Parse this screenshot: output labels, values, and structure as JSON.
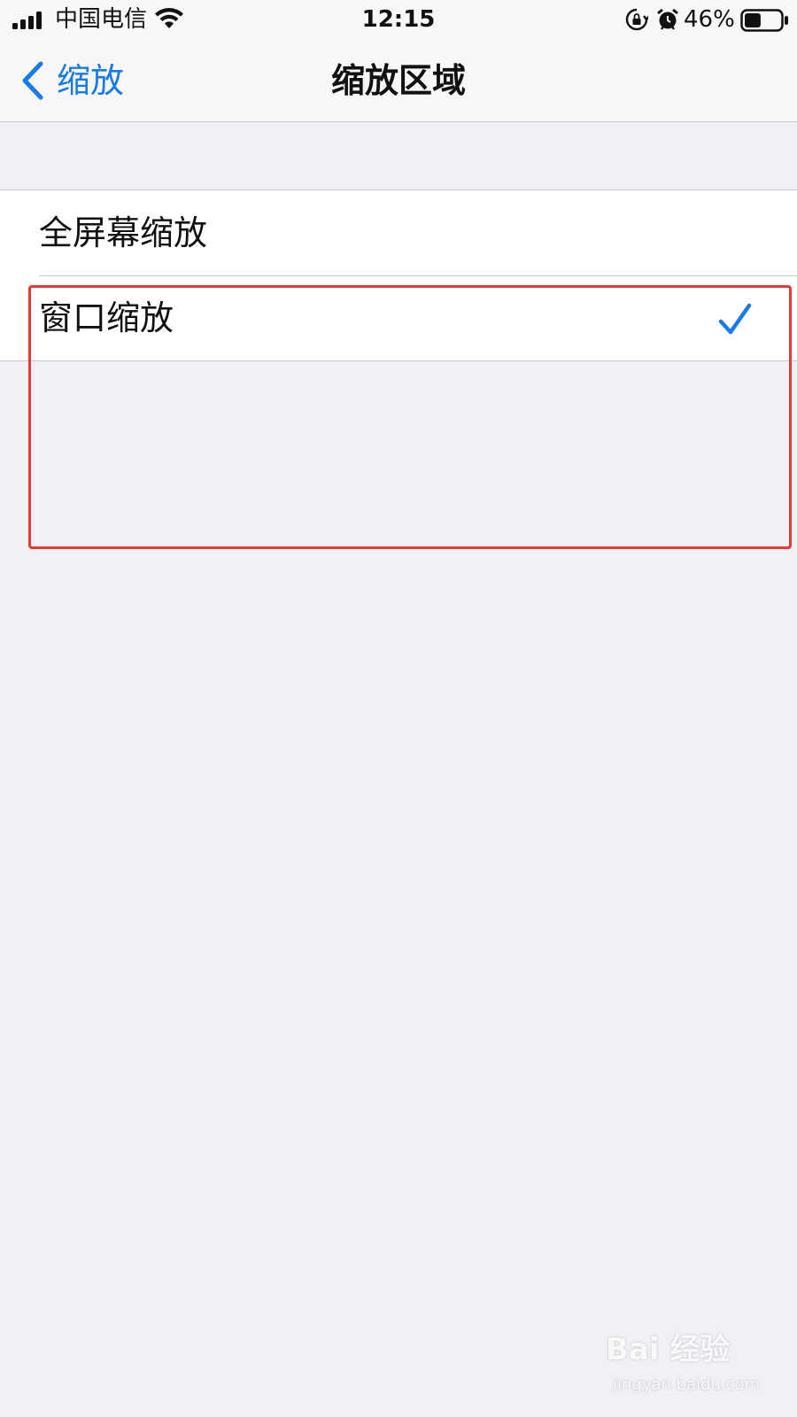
{
  "status_bar": {
    "carrier": "中国电信",
    "time": "12:15",
    "battery_percent": "46%",
    "battery_level": 0.46,
    "icons": [
      "signal-icon",
      "wifi-icon",
      "orientation-lock-icon",
      "alarm-icon",
      "battery-icon"
    ]
  },
  "nav": {
    "back_label": "缩放",
    "title": "缩放区域"
  },
  "options": [
    {
      "label": "全屏幕缩放",
      "selected": false
    },
    {
      "label": "窗口缩放",
      "selected": true
    }
  ],
  "colors": {
    "accent": "#1a7ae6",
    "background": "#f0f0f5",
    "annotation": "#e53935"
  },
  "watermark": {
    "main": "Bai 经验",
    "sub": "jingyan.baidu.com"
  }
}
